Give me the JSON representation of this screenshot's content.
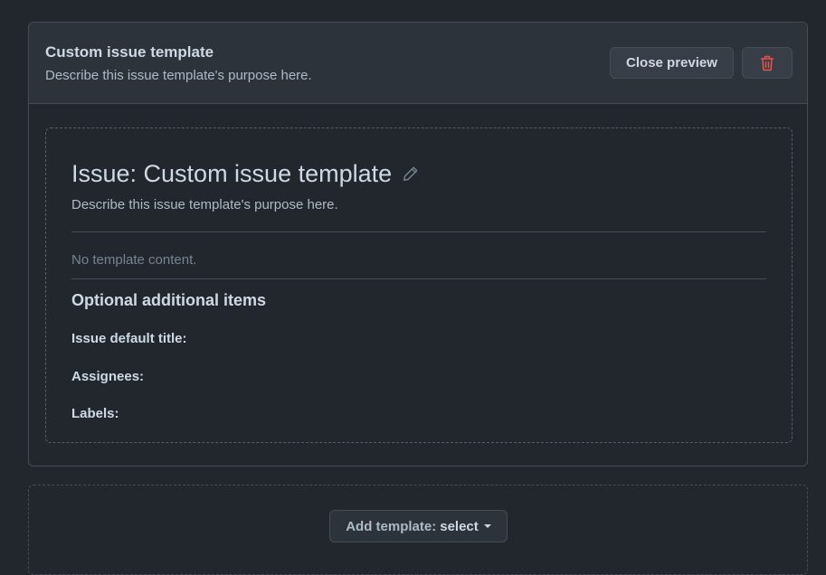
{
  "template_card": {
    "name": "Custom issue template",
    "about": "Describe this issue template's purpose here.",
    "close_preview_label": "Close preview",
    "delete_icon": "trash-icon"
  },
  "preview": {
    "title": "Issue: Custom issue template",
    "edit_icon": "pencil-icon",
    "about": "Describe this issue template's purpose here.",
    "empty_text": "No template content.",
    "optional_heading": "Optional additional items",
    "fields": {
      "default_title_label": "Issue default title:",
      "assignees_label": "Assignees:",
      "labels_label": "Labels:"
    }
  },
  "add_template": {
    "prefix": "Add template:",
    "value": "select"
  },
  "colors": {
    "background": "#22272e",
    "header_bg": "#2d333b",
    "border": "#444c56",
    "danger": "#e5534b",
    "text_primary": "#cdd9e5",
    "text_muted": "#768390"
  }
}
